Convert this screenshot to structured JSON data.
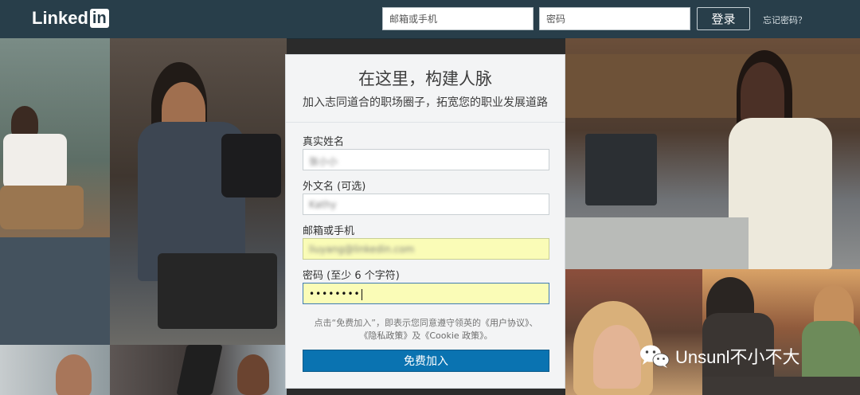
{
  "header": {
    "logo_text": "Linked",
    "logo_badge": "in",
    "email_placeholder": "邮箱或手机",
    "password_placeholder": "密码",
    "login_label": "登录",
    "forgot_label": "忘记密码？"
  },
  "signup": {
    "title": "在这里，构建人脉",
    "subtitle": "加入志同道合的职场圈子，拓宽您的职业发展道路",
    "fields": [
      {
        "label": "真实姓名",
        "value": "张小小"
      },
      {
        "label": "外文名 (可选)",
        "value": "Kathy"
      },
      {
        "label": "邮箱或手机",
        "value": "liuyang@linkedin.com"
      },
      {
        "label": "密码 (至少 6 个字符)",
        "value": "••••••••"
      }
    ],
    "terms_prefix": "点击“免费加入”，即表示您同意遵守领英的",
    "terms_user_agreement": "《用户协议》",
    "terms_sep1": "、",
    "terms_privacy": "《隐私政策》",
    "terms_and": "及",
    "terms_cookie": "《Cookie 政策》",
    "terms_end": "。",
    "join_label": "免费加入"
  },
  "watermark": {
    "text": "Unsunl不小不大"
  },
  "colors": {
    "header_bg": "#283e4a",
    "join_button": "#0a73b1",
    "autofill_yellow": "#fafcb7",
    "card_bg": "#f3f4f5"
  }
}
